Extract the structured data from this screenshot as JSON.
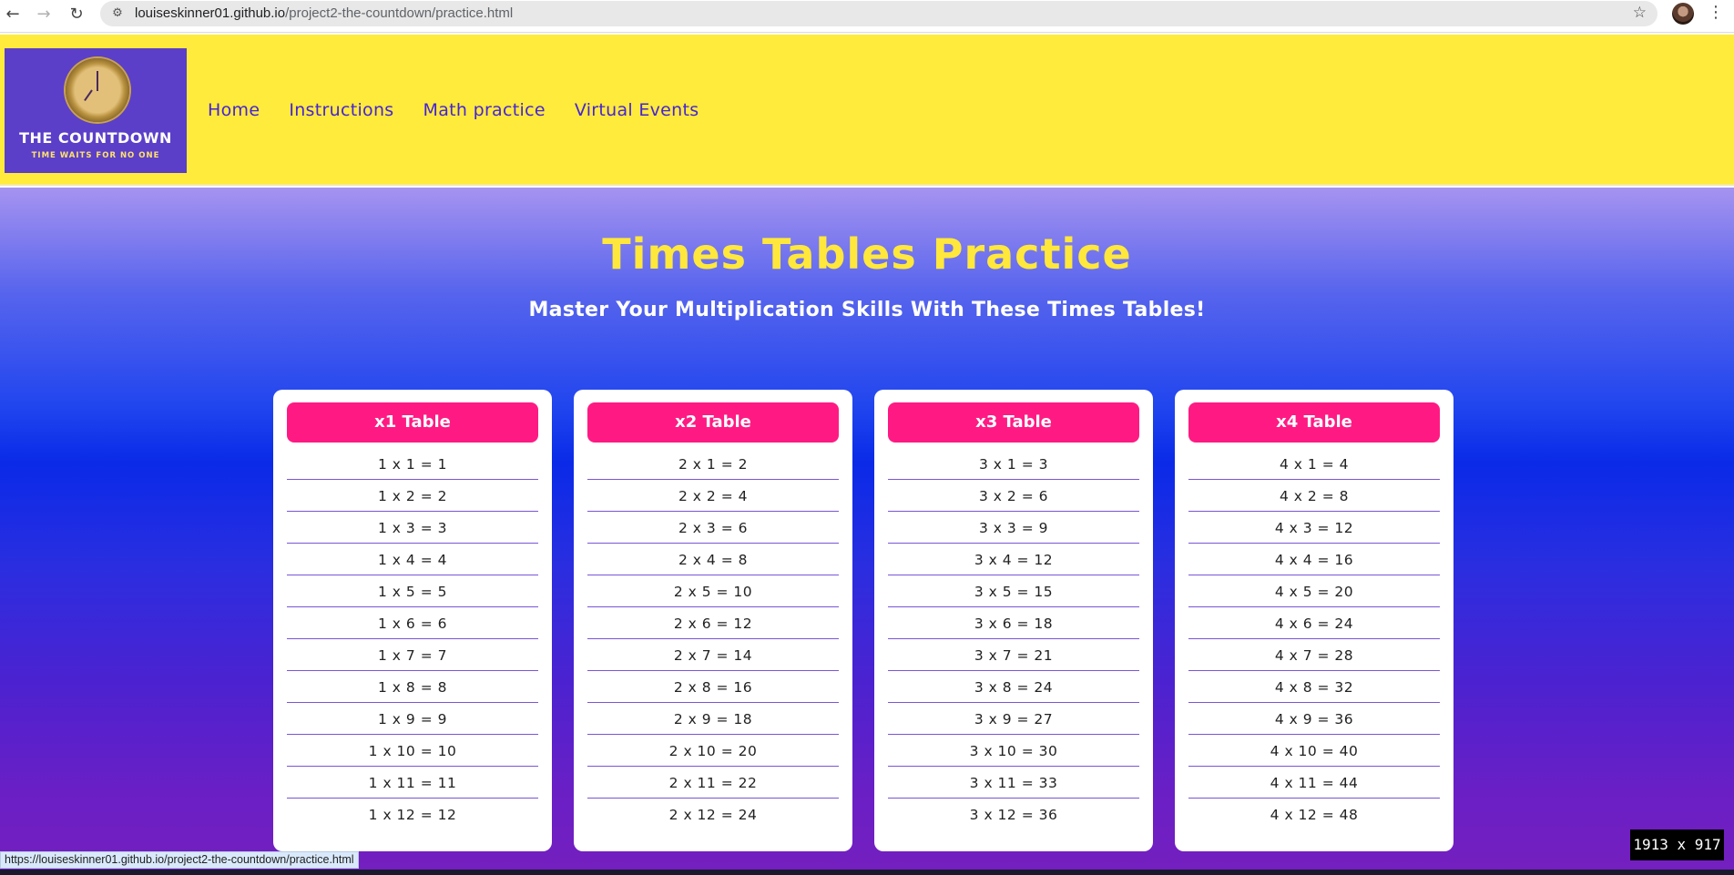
{
  "browser": {
    "url_domain": "louiseskinner01.github.io",
    "url_path": "/project2-the-countdown/practice.html",
    "status_url": "https://louiseskinner01.github.io/project2-the-countdown/practice.html",
    "dimensions_badge": "1913 x 917",
    "icons": [
      "back-icon",
      "forward-icon",
      "reload-icon",
      "site-info-icon",
      "star-icon",
      "avatar",
      "menu-icon"
    ]
  },
  "header": {
    "logo_title": "THE COUNTDOWN",
    "logo_tagline": "TIME WAITS FOR NO ONE",
    "nav": [
      "Home",
      "Instructions",
      "Math practice",
      "Virtual Events"
    ]
  },
  "main": {
    "title": "Times Tables Practice",
    "subtitle": "Master Your Multiplication Skills With These Times Tables!",
    "tables": [
      {
        "title": "x1 Table",
        "rows": [
          "1 x 1 = 1",
          "1 x 2 = 2",
          "1 x 3 = 3",
          "1 x 4 = 4",
          "1 x 5 = 5",
          "1 x 6 = 6",
          "1 x 7 = 7",
          "1 x 8 = 8",
          "1 x 9 = 9",
          "1 x 10 = 10",
          "1 x 11 = 11",
          "1 x 12 = 12"
        ]
      },
      {
        "title": "x2 Table",
        "rows": [
          "2 x 1 = 2",
          "2 x 2 = 4",
          "2 x 3 = 6",
          "2 x 4 = 8",
          "2 x 5 = 10",
          "2 x 6 = 12",
          "2 x 7 = 14",
          "2 x 8 = 16",
          "2 x 9 = 18",
          "2 x 10 = 20",
          "2 x 11 = 22",
          "2 x 12 = 24"
        ]
      },
      {
        "title": "x3 Table",
        "rows": [
          "3 x 1 = 3",
          "3 x 2 = 6",
          "3 x 3 = 9",
          "3 x 4 = 12",
          "3 x 5 = 15",
          "3 x 6 = 18",
          "3 x 7 = 21",
          "3 x 8 = 24",
          "3 x 9 = 27",
          "3 x 10 = 30",
          "3 x 11 = 33",
          "3 x 12 = 36"
        ]
      },
      {
        "title": "x4 Table",
        "rows": [
          "4 x 1 = 4",
          "4 x 2 = 8",
          "4 x 3 = 12",
          "4 x 4 = 16",
          "4 x 5 = 20",
          "4 x 6 = 24",
          "4 x 7 = 28",
          "4 x 8 = 32",
          "4 x 9 = 36",
          "4 x 10 = 40",
          "4 x 11 = 44",
          "4 x 12 = 48"
        ]
      }
    ]
  },
  "colors": {
    "header_bg": "#ffeb3b",
    "nav_link": "#4524d6",
    "title": "#ffe83b",
    "card_header": "#ff1a83",
    "row_divider": "#7a55d6"
  }
}
